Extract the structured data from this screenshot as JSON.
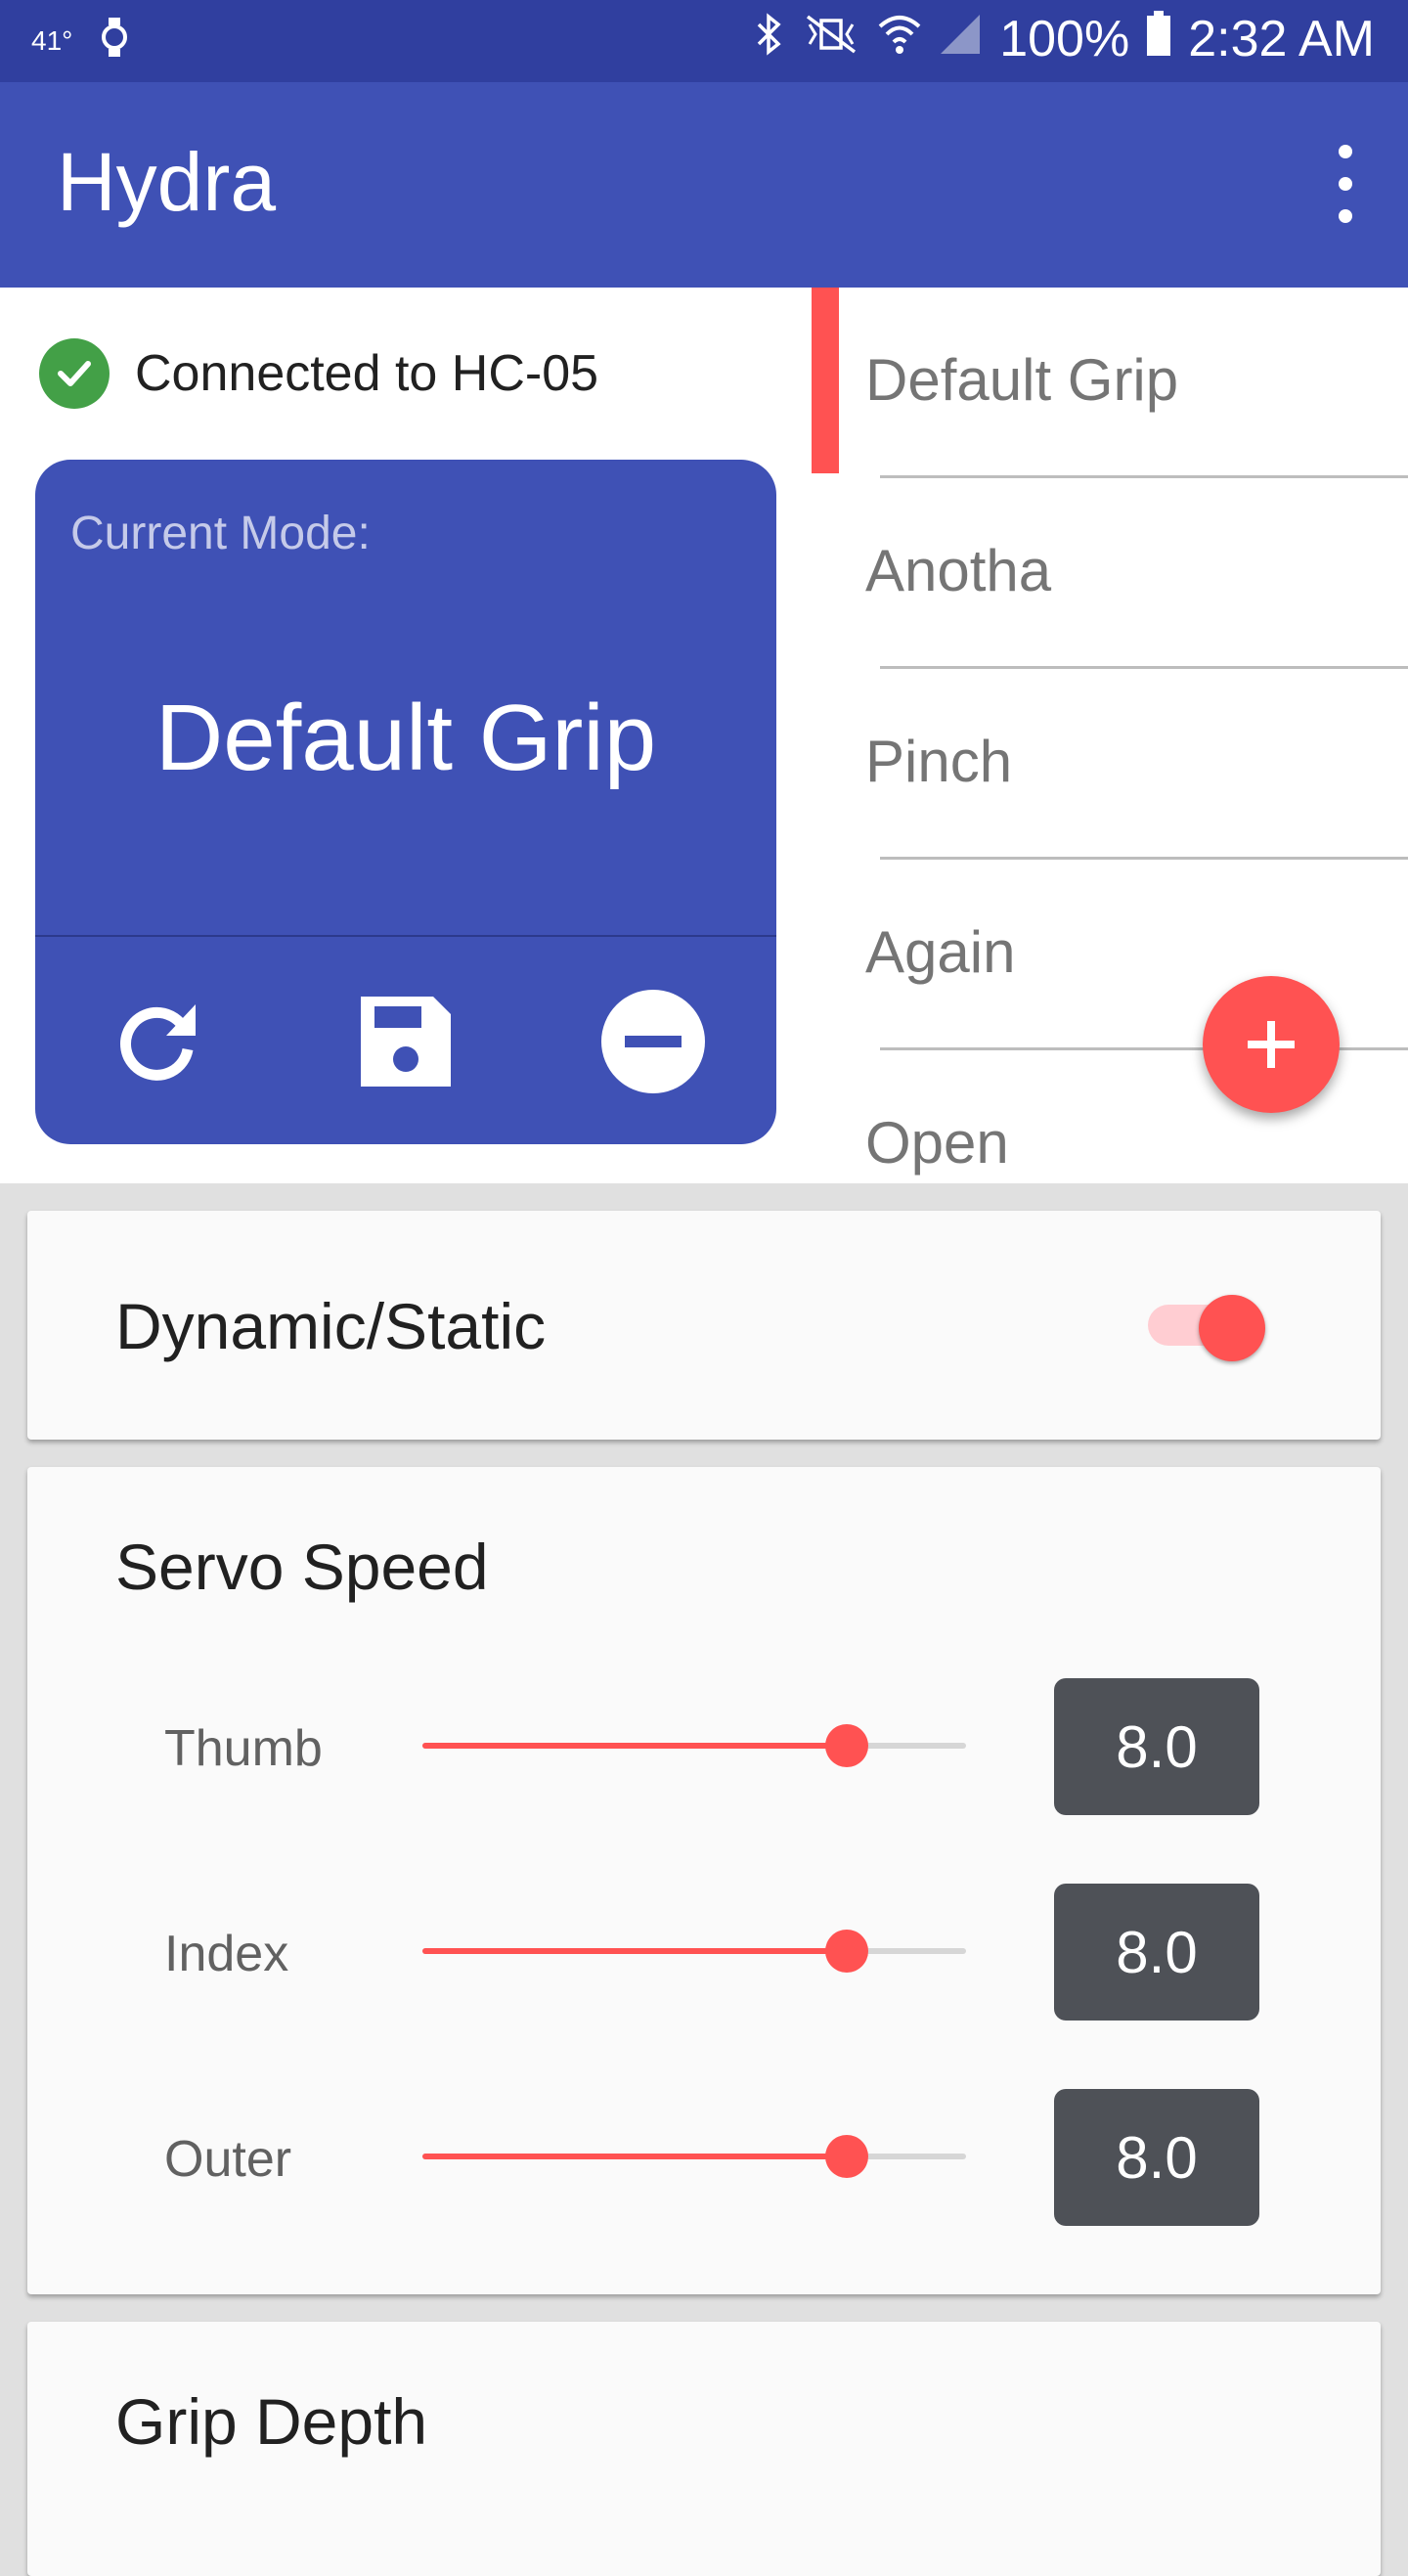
{
  "status_bar": {
    "temperature": "41°",
    "battery": "100%",
    "time": "2:32 AM"
  },
  "app_bar": {
    "title": "Hydra"
  },
  "connection": {
    "text": "Connected to HC-05"
  },
  "current_mode": {
    "label": "Current Mode:",
    "name": "Default Grip"
  },
  "grips": [
    {
      "label": "Default Grip",
      "selected": true
    },
    {
      "label": "Anotha",
      "selected": false
    },
    {
      "label": "Pinch",
      "selected": false
    },
    {
      "label": "Again",
      "selected": false
    },
    {
      "label": "Open",
      "selected": false
    }
  ],
  "dynamic_static": {
    "title": "Dynamic/Static",
    "enabled": true
  },
  "servo_speed": {
    "title": "Servo Speed",
    "sliders": [
      {
        "label": "Thumb",
        "value": "8.0",
        "fraction": 0.78
      },
      {
        "label": "Index",
        "value": "8.0",
        "fraction": 0.78
      },
      {
        "label": "Outer",
        "value": "8.0",
        "fraction": 0.78
      }
    ]
  },
  "grip_depth": {
    "title": "Grip Depth"
  },
  "colors": {
    "primary": "#3f51b5",
    "primary_dark": "#303f9f",
    "accent": "#ff5252",
    "success": "#43a047"
  }
}
